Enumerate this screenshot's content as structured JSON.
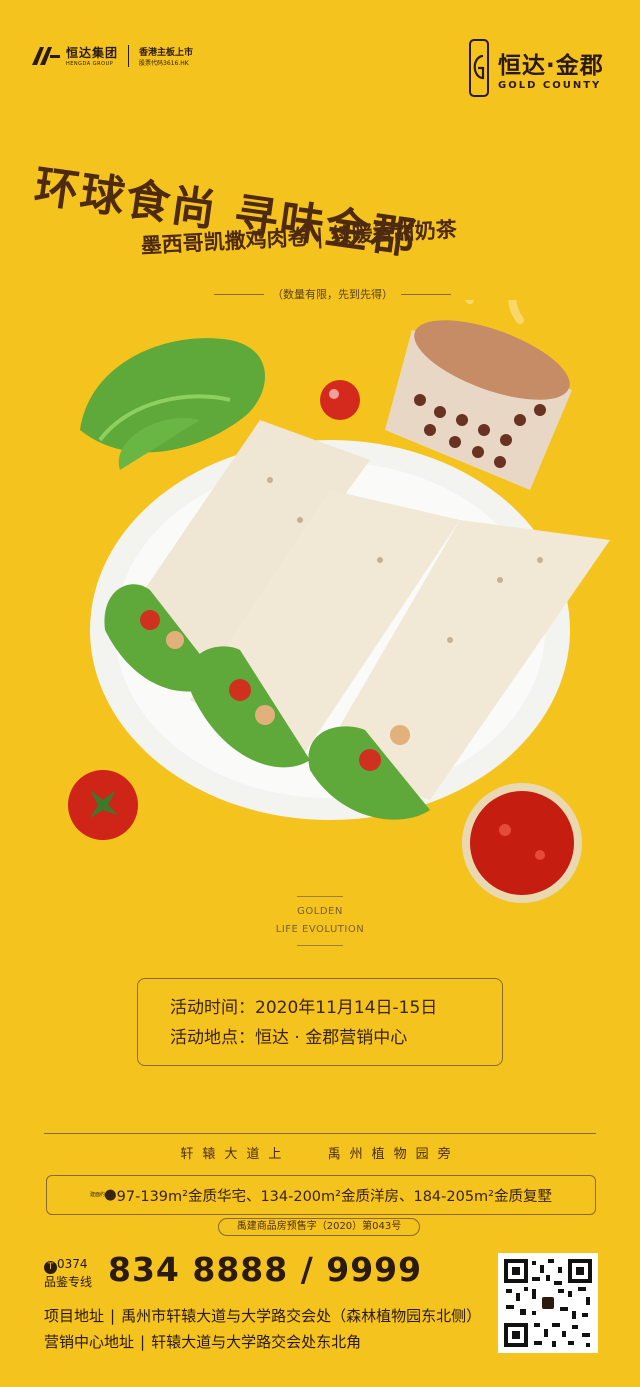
{
  "header": {
    "developer_name": "恒达集团",
    "developer_en": "HENGDA GROUP",
    "listing_line1": "香港主板上市",
    "listing_line2": "股票代码3616.HK",
    "project_cn": "恒达·金郡",
    "project_en": "GOLD COUNTY"
  },
  "headline": {
    "title": "环球食尚 寻味金郡",
    "subtitle": "墨西哥凯撒鸡肉卷 | 续暖香甜奶茶",
    "limited": "（数量有限，先到先得）"
  },
  "golden": {
    "line1": "GOLDEN",
    "line2": "LIFE EVOLUTION"
  },
  "activity": {
    "time": "活动时间：2020年11月14日-15日",
    "place": "活动地点：恒达 · 金郡营销中心"
  },
  "location": {
    "part1": "轩辕大道上",
    "part2": "禹州植物园旁"
  },
  "products": {
    "prefix": "建面约",
    "text": "97-139m²金质华宅、134-200m²金质洋房、184-205m²金质复墅"
  },
  "license": "禹建商品房预售字（2020）第043号",
  "hotline": {
    "prefix": "T",
    "area": "0374",
    "label": "品鉴专线",
    "number": "834 8888 / 9999"
  },
  "address": {
    "project_label": "项目地址",
    "project_value": "禹州市轩辕大道与大学路交会处（森林植物园东北侧）",
    "office_label": "营销中心地址",
    "office_value": "轩辕大道与大学路交会处东北角"
  },
  "colors": {
    "background": "#F5C31E",
    "text_dark": "#4e2a10"
  }
}
